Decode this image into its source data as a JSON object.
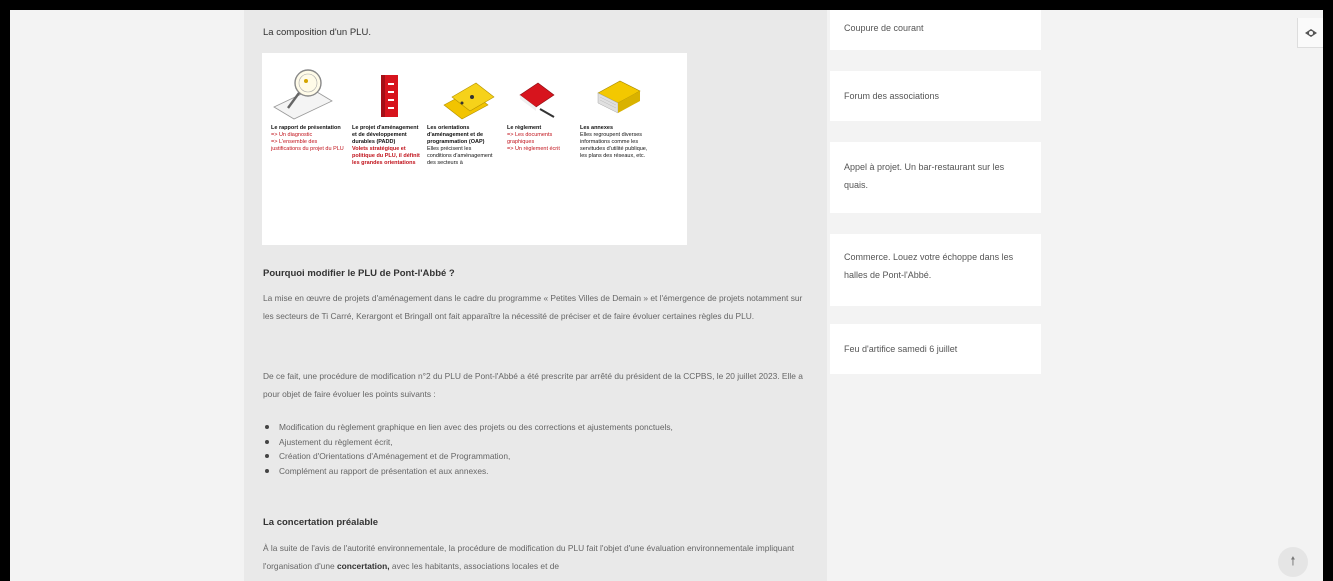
{
  "article": {
    "composition_heading": "La composition d'un PLU.",
    "figure": {
      "items": [
        {
          "title": "Le rapport de présentation",
          "lines": [
            "=> Un diagnostic",
            "=> L'ensemble des justifications du projet du PLU"
          ]
        },
        {
          "title": "Le projet d'aménagement et de développement durables (PADD)",
          "lines": [
            "Volets stratégique et politique du PLU, il définit les grandes orientations"
          ]
        },
        {
          "title": "Les orientations d'aménagement et de programmation (OAP)",
          "lines": [
            "Elles précisent les conditions d'aménagement des secteurs à"
          ]
        },
        {
          "title": "Le règlement",
          "lines": [
            "=> Les documents graphiques",
            "=> Un règlement écrit"
          ]
        },
        {
          "title": "Les annexes",
          "lines": [
            "Elles regroupent diverses informations comme les servitudes d'utilité publique, les plans des réseaux, etc."
          ]
        }
      ]
    },
    "why_heading": "Pourquoi modifier le PLU de Pont-l'Abbé ?",
    "why_para": "La mise en œuvre de projets d'aménagement dans le cadre du programme « Petites Villes de Demain » et l'émergence de projets notamment sur les secteurs de Ti Carré, Kerargont et Bringall ont fait apparaître la nécessité de préciser et de faire évoluer certaines règles du PLU.",
    "procedure_para": "De ce fait, une procédure de modification n°2 du PLU de Pont-l'Abbé a été prescrite par arrêté du président de la CCPBS, le 20 juillet 2023. Elle a pour objet de faire évoluer les points suivants :",
    "bullets": [
      "Modification du règlement graphique en lien avec des projets ou des corrections et ajustements ponctuels,",
      "Ajustement du règlement écrit,",
      "Création d'Orientations d'Aménagement et de Programmation,",
      "Complément au rapport de présentation et aux annexes."
    ],
    "concertation_heading": "La concertation préalable",
    "concertation_para_start": "À la suite de l'avis de l'autorité environnementale, la procédure de modification du PLU fait l'objet d'une évaluation environnementale impliquant l'organisation d'une ",
    "concertation_bold": "concertation,",
    "concertation_para_end": " avec les habitants, associations locales et de"
  },
  "sidebar": {
    "cards": [
      "Coupure de courant",
      "Forum des associations",
      "Appel à projet. Un bar-restaurant sur les quais.",
      "Commerce. Louez votre échoppe dans les halles de Pont-l'Abbé.",
      "Feu d'artifice samedi 6 juillet"
    ]
  },
  "icons": {
    "accessibility": "accessibility-icon",
    "back_to_top": "arrow-up-icon"
  }
}
